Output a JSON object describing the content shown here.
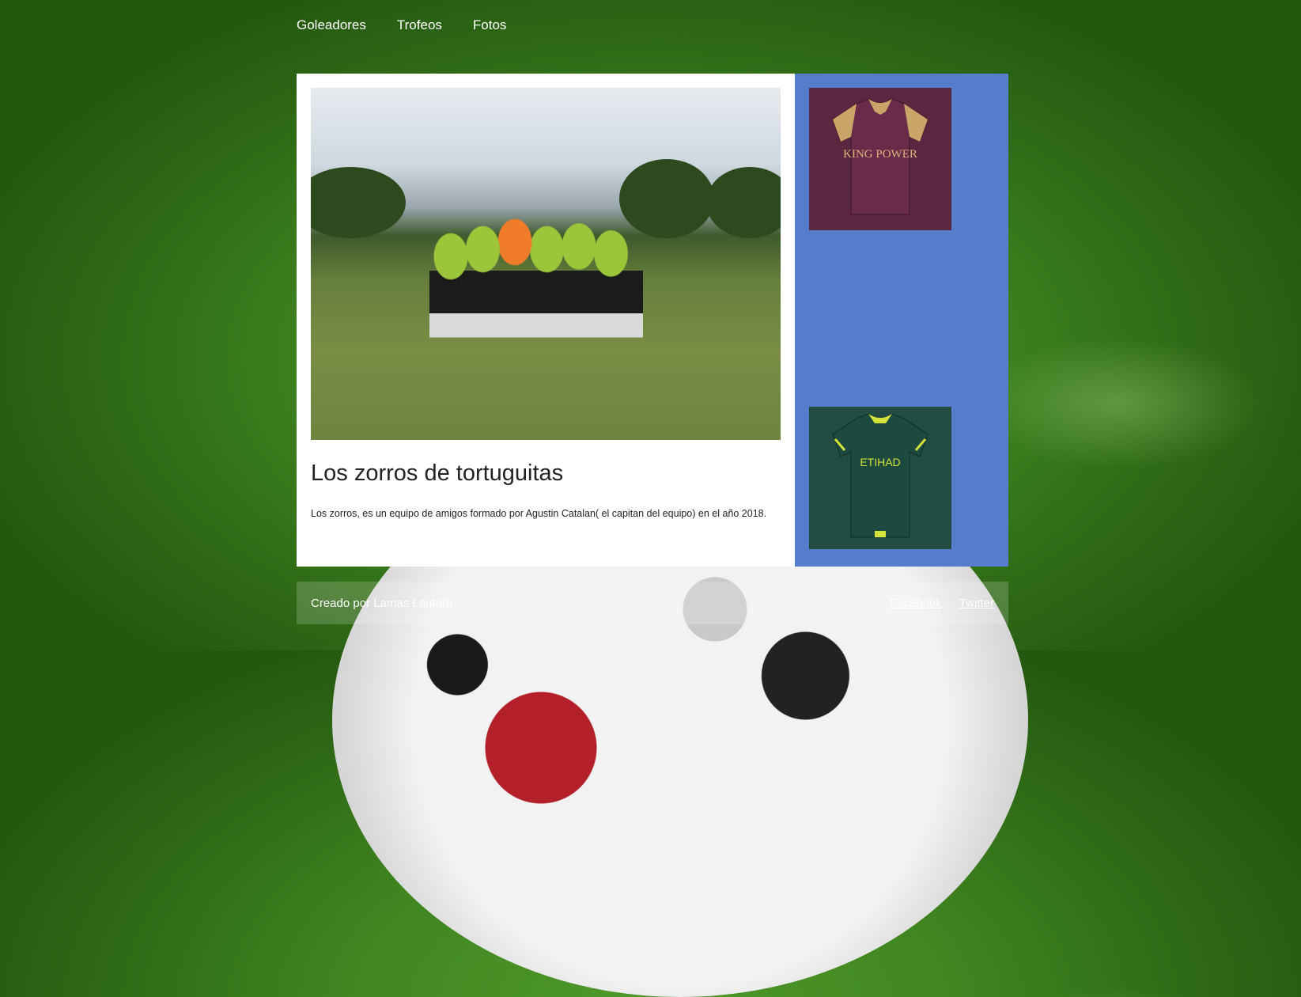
{
  "nav": {
    "items": [
      {
        "label": "Goleadores"
      },
      {
        "label": "Trofeos"
      },
      {
        "label": "Fotos"
      }
    ]
  },
  "article": {
    "title": "Los zorros de tortuguitas",
    "description": "Los zorros, es un equipo de amigos formado por Agustin Catalan( el capitan del equipo) en el año 2018."
  },
  "sidebar": {
    "jerseys": [
      {
        "brand_text": "KING POWER",
        "color": "#5b2740"
      },
      {
        "brand_text": "ETIHAD",
        "color": "#224c43"
      }
    ]
  },
  "footer": {
    "credit": "Creado por Lamas Lautaro",
    "links": [
      {
        "label": "Facebook"
      },
      {
        "label": "Twitter"
      }
    ]
  }
}
